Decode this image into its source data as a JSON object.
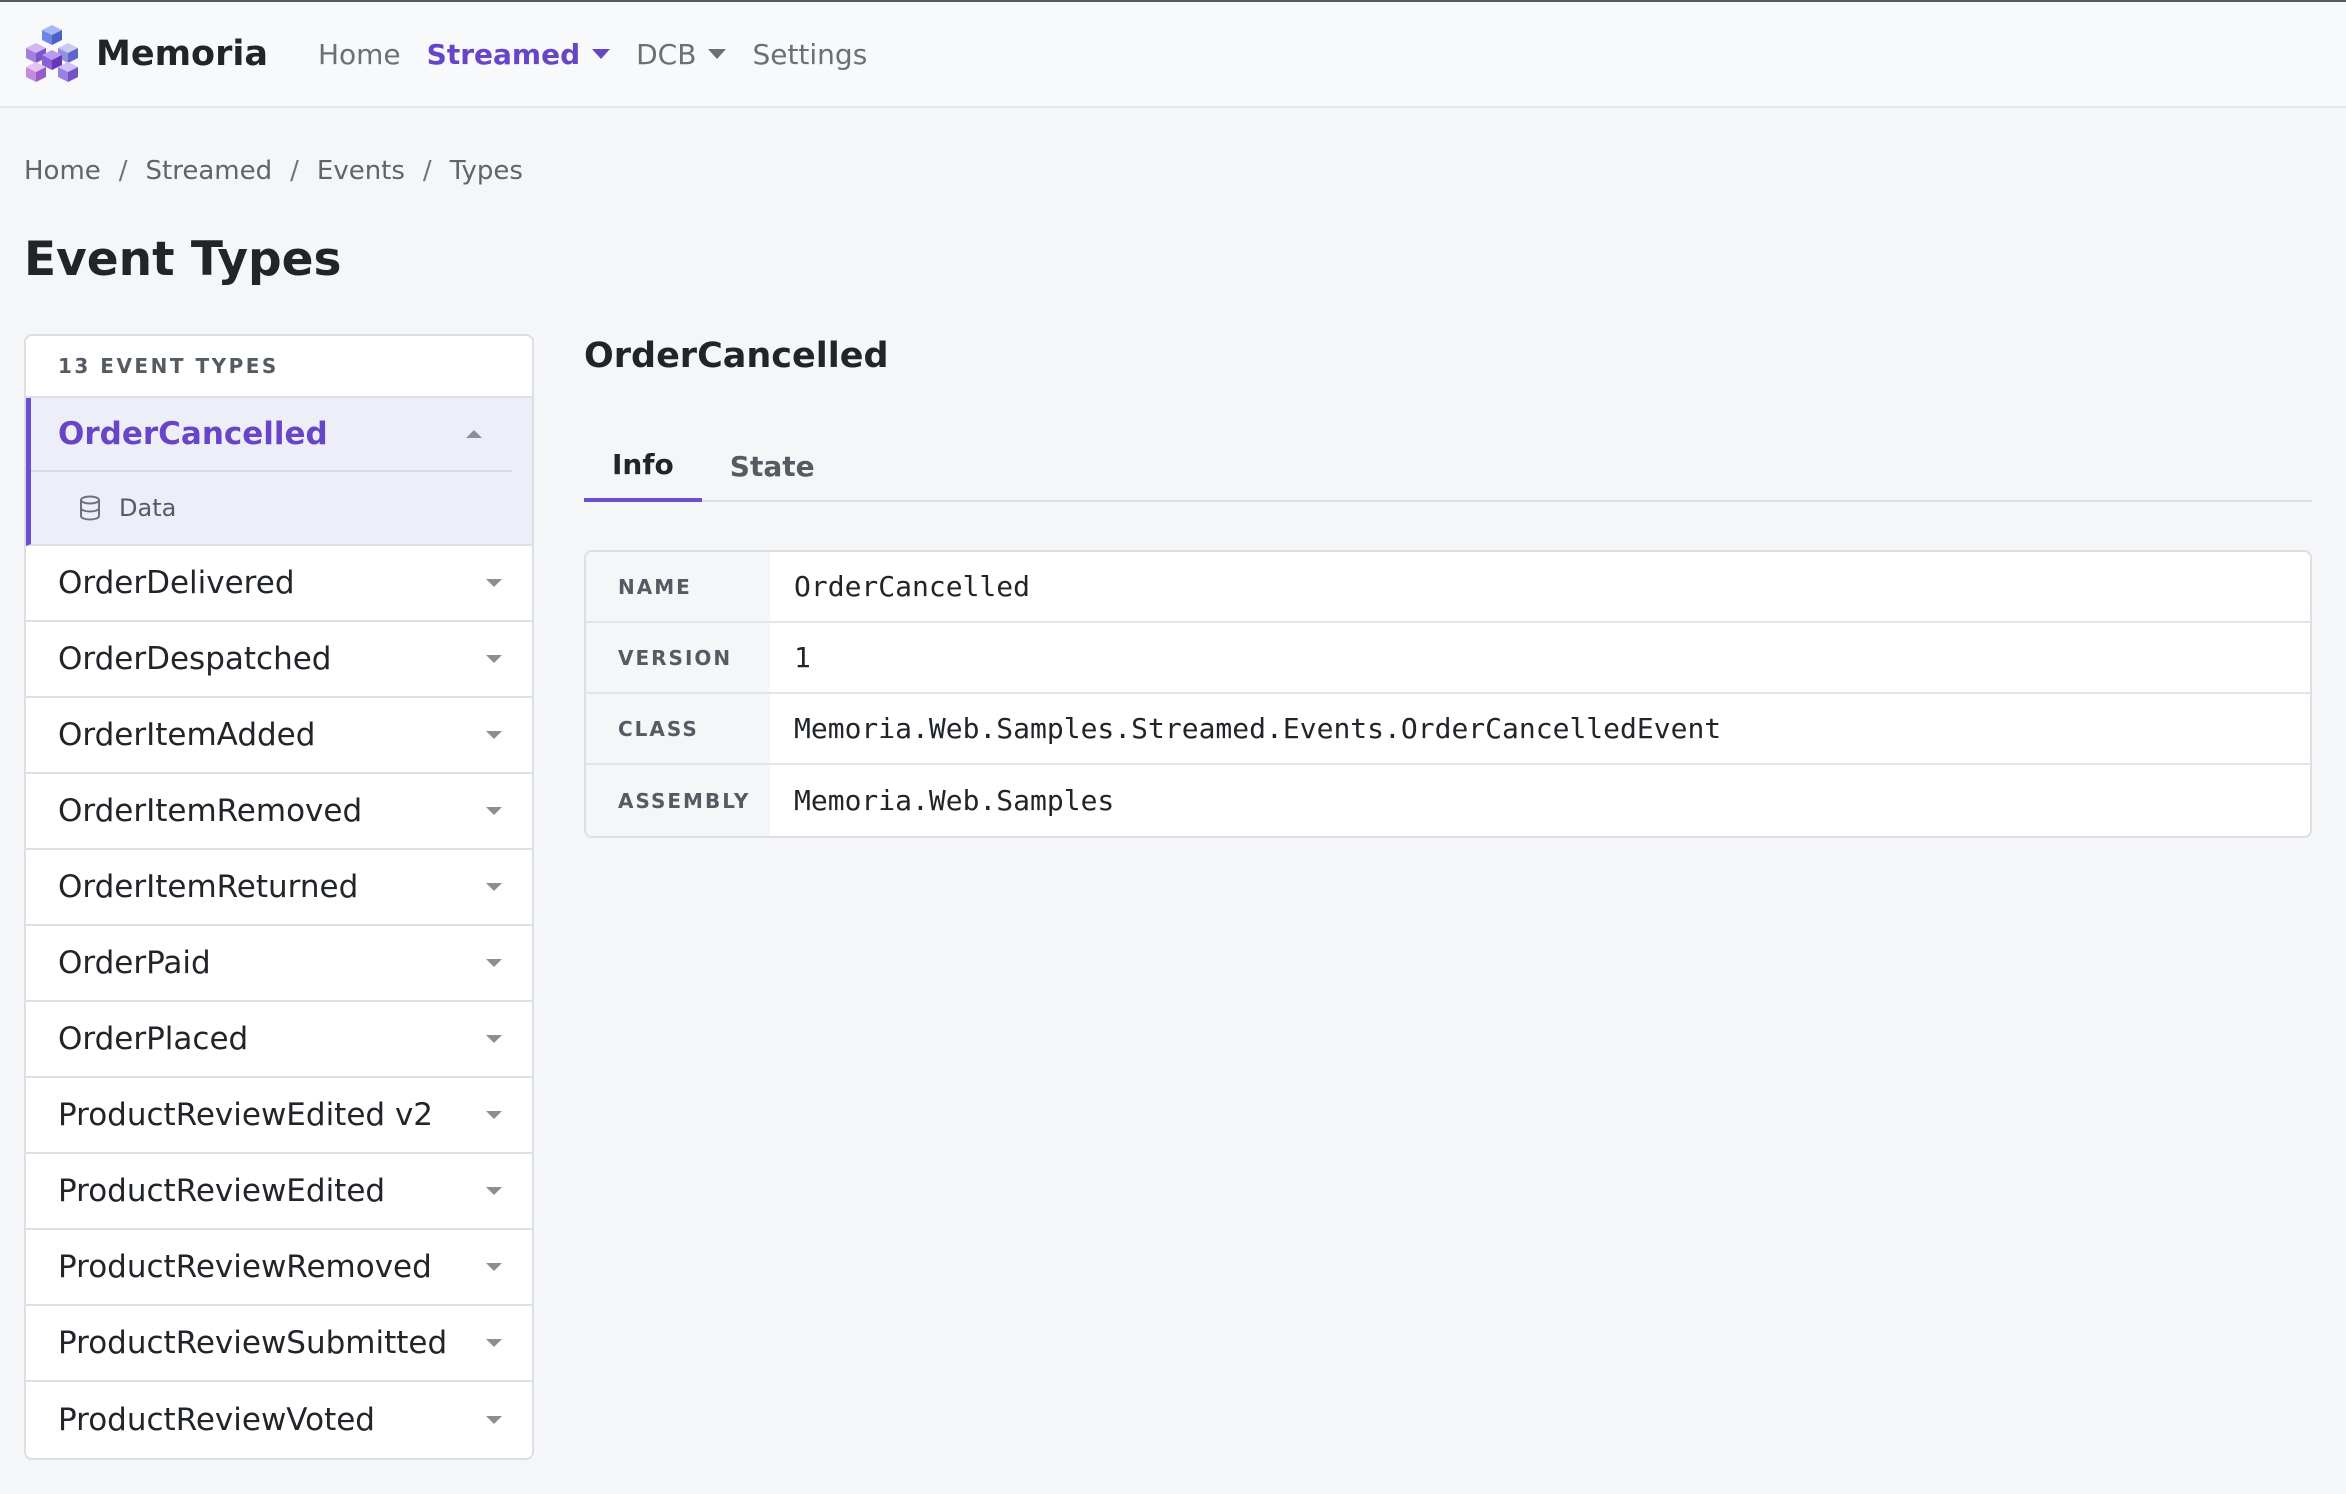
{
  "app": {
    "brand": "Memoria",
    "nav": [
      {
        "label": "Home"
      },
      {
        "label": "Streamed"
      },
      {
        "label": "DCB"
      },
      {
        "label": "Settings"
      }
    ]
  },
  "breadcrumb": [
    "Home",
    "Streamed",
    "Events",
    "Types"
  ],
  "page_title": "Event Types",
  "sidebar": {
    "header": "13 EVENT TYPES",
    "active": {
      "label": "OrderCancelled",
      "sub_label": "Data"
    },
    "items": [
      "OrderDelivered",
      "OrderDespatched",
      "OrderItemAdded",
      "OrderItemRemoved",
      "OrderItemReturned",
      "OrderPaid",
      "OrderPlaced",
      "ProductReviewEdited v2",
      "ProductReviewEdited",
      "ProductReviewRemoved",
      "ProductReviewSubmitted",
      "ProductReviewVoted"
    ]
  },
  "detail": {
    "title": "OrderCancelled",
    "tabs": [
      "Info",
      "State"
    ],
    "info": [
      {
        "key": "NAME",
        "value": "OrderCancelled"
      },
      {
        "key": "VERSION",
        "value": "1"
      },
      {
        "key": "CLASS",
        "value": "Memoria.Web.Samples.Streamed.Events.OrderCancelledEvent"
      },
      {
        "key": "ASSEMBLY",
        "value": "Memoria.Web.Samples"
      }
    ]
  },
  "colors": {
    "accent": "#6845c7",
    "active_bg": "#eeeef9",
    "page_bg": "#f5f6f8"
  },
  "icons": {
    "brand": "cubes-logo-icon",
    "sub_item": "database-icon",
    "dropdown": "caret-down-icon",
    "collapse": "caret-up-icon"
  }
}
